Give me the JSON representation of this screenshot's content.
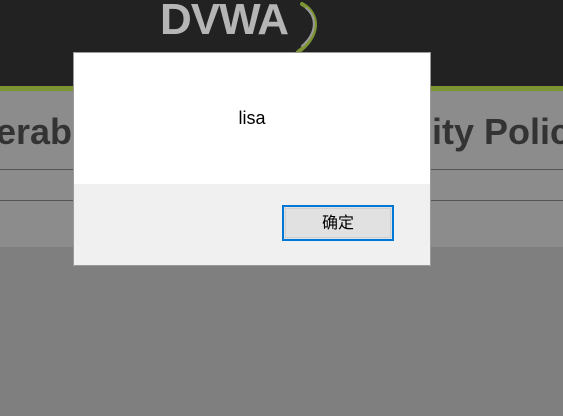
{
  "background_page": {
    "logo_text": "DVWA",
    "heading_left": "erab",
    "heading_right": "ity Polic",
    "colors": {
      "header": "#222222",
      "accent": "#7d9432",
      "overlay": "#808080"
    }
  },
  "dialog": {
    "message": "lisa",
    "ok_label": "确定",
    "colors": {
      "body": "#ffffff",
      "footer": "#f0f0f0",
      "button_border": "#0078d7",
      "button_face": "#e1e1e1"
    }
  }
}
